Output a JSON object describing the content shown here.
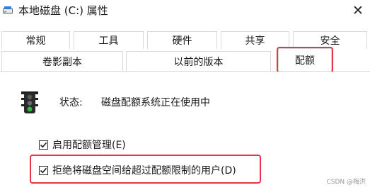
{
  "window": {
    "title": "本地磁盘 (C:) 属性",
    "close_glyph": "✕"
  },
  "tabs_row1": [
    {
      "label": "常规"
    },
    {
      "label": "工具"
    },
    {
      "label": "硬件"
    },
    {
      "label": "共享"
    },
    {
      "label": "安全"
    }
  ],
  "tabs_row2": [
    {
      "label": "卷影副本"
    },
    {
      "label": "以前的版本"
    },
    {
      "label": "配额",
      "active": true
    }
  ],
  "quota": {
    "status_label": "状态:",
    "status_value": "磁盘配额系统正在使用中",
    "enable_quota": {
      "label": "启用配额管理(E)",
      "checked": true
    },
    "deny_space": {
      "label": "拒绝将磁盘空间给超过配额限制的用户(D)",
      "checked": true
    }
  },
  "watermark": "CSDN @梅洪",
  "colors": {
    "highlight": "#e8334a",
    "drive_icon": "#2e7fd8"
  }
}
